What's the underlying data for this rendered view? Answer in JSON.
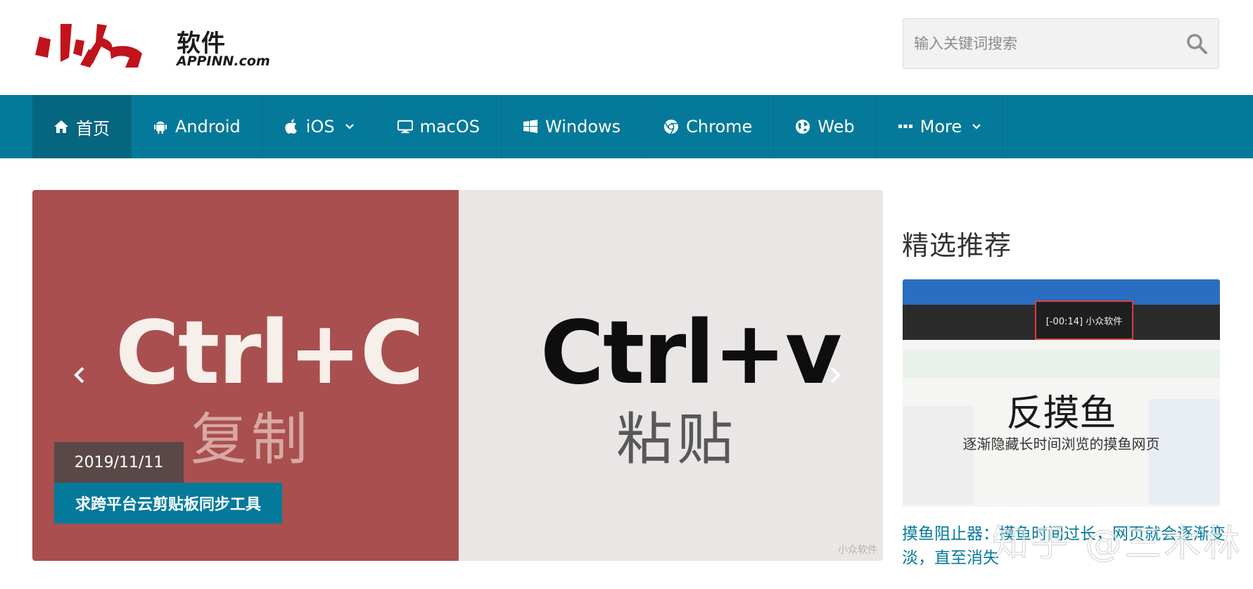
{
  "logo": {
    "cn": "软件",
    "en": "APPINN.com",
    "mark_color": "#c0131b"
  },
  "search": {
    "placeholder": "输入关键词搜索",
    "icon": "search-icon"
  },
  "nav": {
    "background": "#05799a",
    "items": [
      {
        "label": "首页",
        "icon": "home-icon",
        "active": true
      },
      {
        "label": "Android",
        "icon": "android-icon"
      },
      {
        "label": "iOS",
        "icon": "apple-icon",
        "dropdown": true
      },
      {
        "label": "macOS",
        "icon": "monitor-icon"
      },
      {
        "label": "Windows",
        "icon": "windows-icon"
      },
      {
        "label": "Chrome",
        "icon": "chrome-icon"
      },
      {
        "label": "Web",
        "icon": "globe-icon"
      },
      {
        "label": "More",
        "icon": "ellipsis-icon",
        "dropdown": true
      }
    ]
  },
  "slider": {
    "left_key": "Ctrl+C",
    "left_cn": "复制",
    "right_key": "Ctrl+v",
    "right_cn": "粘贴",
    "date": "2019/11/11",
    "title": "求跨平台云剪贴板同步工具",
    "watermark": "小众软件"
  },
  "sidebar": {
    "title": "精选推荐",
    "featured": {
      "popup_text": "[-00:14] 小众软件",
      "heading": "反摸鱼",
      "subheading": "逐渐隐藏长时间浏览的摸鱼网页",
      "caption": "摸鱼阻止器：摸鱼时间过长，网页就会逐渐变淡，直至消失"
    }
  },
  "overlay_watermark": "知乎 @三木林"
}
